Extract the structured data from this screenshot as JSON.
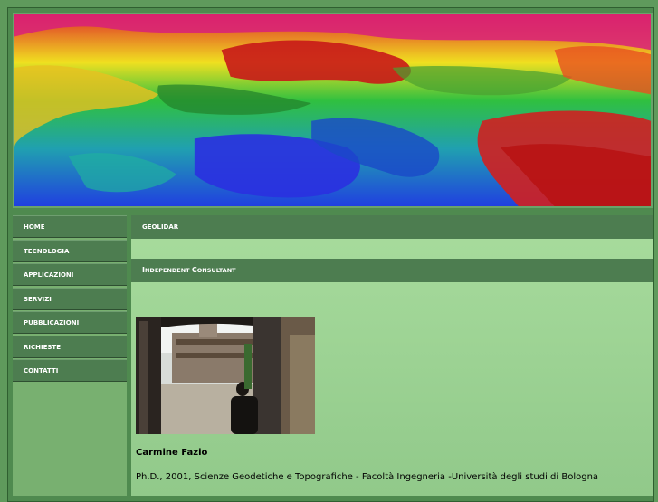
{
  "nav": [
    {
      "label": "HOME"
    },
    {
      "label": "TECNOLOGIA"
    },
    {
      "label": "APPLICAZIONI"
    },
    {
      "label": "SERVIZI"
    },
    {
      "label": "PUBBLICAZIONI"
    },
    {
      "label": "RICHIESTE"
    },
    {
      "label": "CONTATTI"
    }
  ],
  "main": {
    "section_label": "GEOLIDAR",
    "subheading_first": "I",
    "subheading_rest1": "NDEPENDENT ",
    "subheading_second": "C",
    "subheading_rest2": "ONSULTANT",
    "person_name": "Carmine Fazio",
    "degree": "Ph.D., 2001, Scienze Geodetiche e Topografiche - Facoltà Ingegneria -Università degli studi di Bologna"
  },
  "colors": {
    "background": "#5f9a5c",
    "nav_bg": "#4d7d50",
    "content_bg": "#a8dc9d"
  }
}
